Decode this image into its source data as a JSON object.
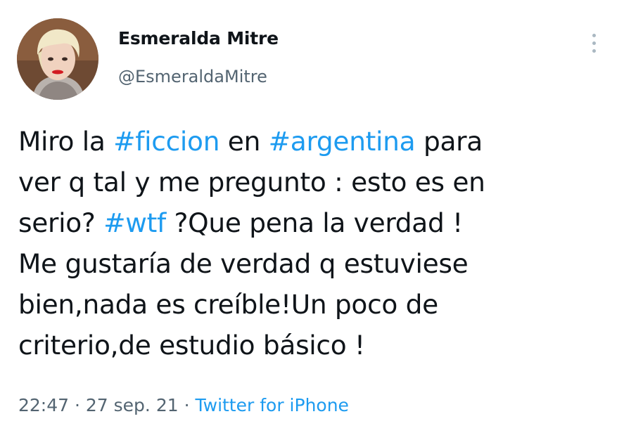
{
  "author": {
    "display_name": "Esmeralda Mitre",
    "handle": "@EsmeraldaMitre",
    "avatar_icon": "profile-photo"
  },
  "tweet": {
    "lines": [
      [
        "Miro la ",
        "#ficcion",
        " en ",
        "#argentina",
        " para"
      ],
      [
        "ver q tal y me pregunto : esto es en"
      ],
      [
        "serio? ",
        "#wtf",
        " ?Que pena la verdad !"
      ],
      [
        "Me gustaría de verdad q estuviese"
      ],
      [
        "bien,nada es creíble!Un poco de"
      ],
      [
        "criterio,de estudio básico !"
      ]
    ],
    "hashtags": [
      "#ficcion",
      "#argentina",
      "#wtf"
    ]
  },
  "meta": {
    "time": "22:47",
    "separator_1": " · ",
    "date": "27 sep. 21",
    "separator_2": " · ",
    "source": "Twitter for iPhone"
  },
  "menu_icon": "more-vertical-icon",
  "colors": {
    "link": "#1d9bf0",
    "text": "#0f1419",
    "secondary": "#536471",
    "background": "#ffffff"
  }
}
